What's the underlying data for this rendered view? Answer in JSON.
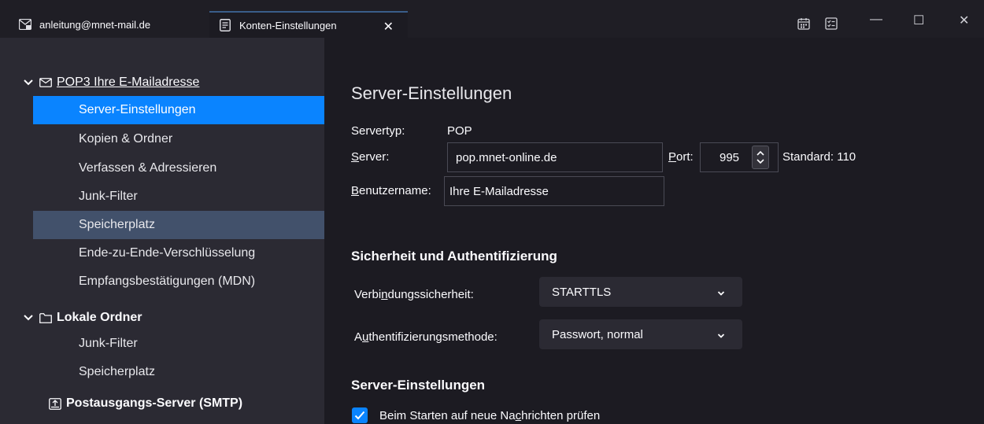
{
  "tabs": [
    {
      "label": "anleitung@mnet-mail.de",
      "icon": "mail-account-icon"
    },
    {
      "label": "Konten-Einstellungen",
      "icon": "document-icon"
    }
  ],
  "window_controls": {
    "minimize": "—",
    "maximize": "☐",
    "close": "✕"
  },
  "sidebar": {
    "account1": {
      "prefix": "POP3",
      "name": "Ihre E-Mailadresse"
    },
    "account1_items": [
      {
        "label": "Server-Einstellungen",
        "state": "selected"
      },
      {
        "label": "Kopien & Ordner"
      },
      {
        "label": "Verfassen & Adressieren"
      },
      {
        "label": "Junk-Filter"
      },
      {
        "label": "Speicherplatz",
        "state": "hover"
      },
      {
        "label": "Ende-zu-Ende-Verschlüsselung"
      },
      {
        "label": "Empfangsbestätigungen (MDN)"
      }
    ],
    "account2": {
      "name": "Lokale Ordner"
    },
    "account2_items": [
      {
        "label": "Junk-Filter"
      },
      {
        "label": "Speicherplatz"
      }
    ],
    "smtp": {
      "label": "Postausgangs-Server (SMTP)"
    }
  },
  "main": {
    "title": "Server-Einstellungen",
    "servertype_label": "Servertyp:",
    "servertype_value": "POP",
    "server_label_u": "S",
    "server_label_rest": "erver:",
    "server_value": "pop.mnet-online.de",
    "port_label_u": "P",
    "port_label_rest": "ort:",
    "port_value": "995",
    "port_default": "Standard: 110",
    "username_label_u": "B",
    "username_label_rest": "enutzername:",
    "username_value": "Ihre E-Mailadresse",
    "security_heading": "Sicherheit und Authentifizierung",
    "conn_label_a": "Verbi",
    "conn_label_u": "n",
    "conn_label_b": "dungssicherheit:",
    "conn_value": "STARTTLS",
    "auth_label_a": "A",
    "auth_label_u": "u",
    "auth_label_b": "thentifizierungsmethode:",
    "auth_value": "Passwort, normal",
    "server_settings_heading": "Server-Einstellungen",
    "check_label_a": "Beim Starten auf neue Na",
    "check_label_u": "c",
    "check_label_b": "hrichten prüfen",
    "check_checked": true
  },
  "colors": {
    "accent": "#0a84ff",
    "sidebar_bg": "#2b2a33",
    "content_bg": "#1c1b22",
    "hover": "#42516b"
  }
}
